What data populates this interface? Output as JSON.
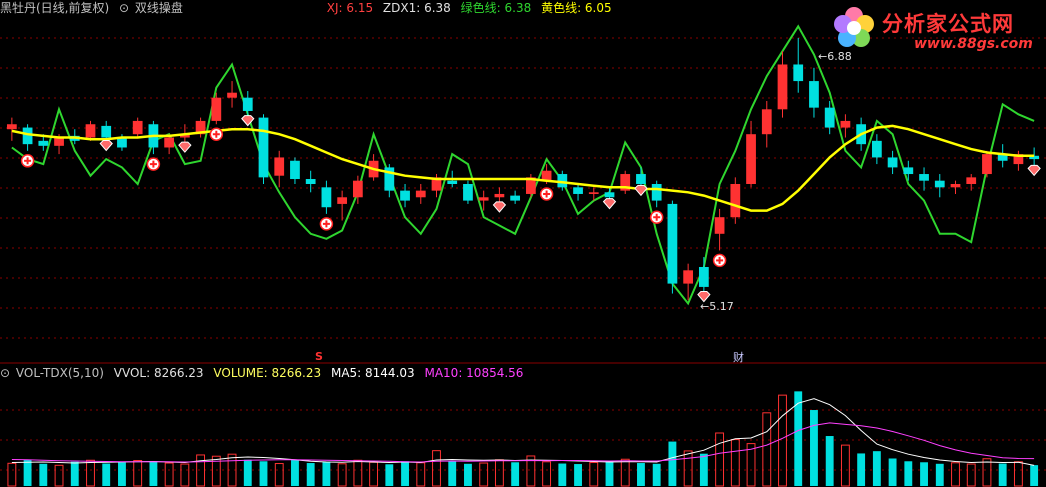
{
  "header": {
    "stock_name": "黑牡丹(日线,前复权)",
    "indicator_name": "双线操盘",
    "xj_label": "XJ: 6.15",
    "zdx1_label": "ZDX1: 6.38",
    "green_label": "绿色线: 6.38",
    "yellow_label": "黄色线: 6.05"
  },
  "volume_header": {
    "name": "VOL-TDX(5,10)",
    "vvol": "VVOL: 8266.23",
    "volume": "VOLUME: 8266.23",
    "ma5": "MA5: 8144.03",
    "ma10": "MA10: 10854.56"
  },
  "annotations": {
    "high_label": "6.88",
    "low_label": "5.17",
    "marker_s": "S",
    "marker_cai": "财"
  },
  "logo": {
    "name": "分析家公式网",
    "url": "www.88gs.com"
  },
  "colors": {
    "up": "#ff3232",
    "down": "#00e0e0",
    "yellow": "#ffff00",
    "green": "#2fd62f",
    "ma10": "#ff40ff",
    "grid": "#8a0000"
  },
  "chart_data": [
    {
      "type": "candlestick",
      "ylim": [
        5.0,
        7.0
      ],
      "low_annotation": 5.17,
      "high_annotation": 6.88,
      "yellow_line": [
        6.32,
        6.3,
        6.29,
        6.28,
        6.28,
        6.27,
        6.27,
        6.28,
        6.28,
        6.29,
        6.29,
        6.3,
        6.31,
        6.32,
        6.33,
        6.33,
        6.32,
        6.3,
        6.27,
        6.23,
        6.19,
        6.15,
        6.12,
        6.09,
        6.07,
        6.05,
        6.04,
        6.03,
        6.03,
        6.03,
        6.03,
        6.03,
        6.03,
        6.03,
        6.02,
        6.01,
        6.0,
        5.99,
        5.98,
        5.98,
        5.97,
        5.97,
        5.96,
        5.95,
        5.93,
        5.9,
        5.87,
        5.84,
        5.84,
        5.88,
        5.96,
        6.06,
        6.16,
        6.24,
        6.3,
        6.34,
        6.35,
        6.33,
        6.3,
        6.27,
        6.24,
        6.21,
        6.19,
        6.18,
        6.17,
        6.17
      ],
      "green_line": [
        6.22,
        6.15,
        6.12,
        6.45,
        6.2,
        6.05,
        6.15,
        6.1,
        6.0,
        6.26,
        6.3,
        6.12,
        6.14,
        6.58,
        6.72,
        6.42,
        6.12,
        5.95,
        5.8,
        5.7,
        5.67,
        5.72,
        5.95,
        6.3,
        6.05,
        5.8,
        5.7,
        5.85,
        6.18,
        6.12,
        5.8,
        5.75,
        5.7,
        5.92,
        6.15,
        6.02,
        5.82,
        5.9,
        5.95,
        6.25,
        6.1,
        5.7,
        5.4,
        5.28,
        5.5,
        6.0,
        6.2,
        6.45,
        6.65,
        6.8,
        6.95,
        6.78,
        6.55,
        6.2,
        6.1,
        6.38,
        6.3,
        6.0,
        5.9,
        5.7,
        5.7,
        5.65,
        6.1,
        6.48,
        6.42,
        6.38
      ],
      "candles": [
        [
          6.33,
          6.4,
          6.26,
          6.36
        ],
        [
          6.34,
          6.36,
          6.2,
          6.24
        ],
        [
          6.26,
          6.3,
          6.2,
          6.23
        ],
        [
          6.23,
          6.3,
          6.18,
          6.28
        ],
        [
          6.29,
          6.33,
          6.24,
          6.26
        ],
        [
          6.28,
          6.38,
          6.26,
          6.36
        ],
        [
          6.35,
          6.38,
          6.25,
          6.28
        ],
        [
          6.28,
          6.3,
          6.2,
          6.22
        ],
        [
          6.3,
          6.4,
          6.28,
          6.38
        ],
        [
          6.36,
          6.38,
          6.18,
          6.22
        ],
        [
          6.22,
          6.3,
          6.18,
          6.28
        ],
        [
          6.28,
          6.36,
          6.24,
          6.3
        ],
        [
          6.3,
          6.4,
          6.28,
          6.38
        ],
        [
          6.38,
          6.55,
          6.36,
          6.52
        ],
        [
          6.52,
          6.62,
          6.46,
          6.55
        ],
        [
          6.52,
          6.56,
          6.4,
          6.44
        ],
        [
          6.4,
          6.42,
          6.0,
          6.04
        ],
        [
          6.05,
          6.2,
          5.98,
          6.16
        ],
        [
          6.14,
          6.16,
          6.0,
          6.03
        ],
        [
          6.03,
          6.08,
          5.95,
          6.0
        ],
        [
          5.98,
          6.02,
          5.82,
          5.86
        ],
        [
          5.88,
          5.96,
          5.78,
          5.92
        ],
        [
          5.92,
          6.05,
          5.88,
          6.02
        ],
        [
          6.04,
          6.18,
          6.02,
          6.14
        ],
        [
          6.1,
          6.12,
          5.92,
          5.96
        ],
        [
          5.96,
          6.0,
          5.86,
          5.9
        ],
        [
          5.92,
          6.0,
          5.88,
          5.96
        ],
        [
          5.96,
          6.06,
          5.92,
          6.04
        ],
        [
          6.02,
          6.08,
          5.98,
          6.0
        ],
        [
          6.0,
          6.02,
          5.88,
          5.9
        ],
        [
          5.9,
          5.96,
          5.84,
          5.92
        ],
        [
          5.92,
          5.98,
          5.88,
          5.94
        ],
        [
          5.93,
          5.96,
          5.88,
          5.9
        ],
        [
          5.94,
          6.06,
          5.92,
          6.04
        ],
        [
          6.02,
          6.12,
          6.0,
          6.08
        ],
        [
          6.06,
          6.08,
          5.96,
          5.98
        ],
        [
          5.98,
          6.0,
          5.9,
          5.94
        ],
        [
          5.94,
          5.98,
          5.9,
          5.95
        ],
        [
          5.95,
          5.98,
          5.9,
          5.92
        ],
        [
          5.96,
          6.08,
          5.94,
          6.06
        ],
        [
          6.06,
          6.1,
          5.98,
          6.0
        ],
        [
          6.0,
          6.02,
          5.86,
          5.9
        ],
        [
          5.88,
          5.9,
          5.34,
          5.4
        ],
        [
          5.4,
          5.52,
          5.3,
          5.48
        ],
        [
          5.5,
          5.56,
          5.34,
          5.38
        ],
        [
          5.7,
          5.85,
          5.6,
          5.8
        ],
        [
          5.8,
          6.04,
          5.76,
          6.0
        ],
        [
          6.0,
          6.38,
          5.98,
          6.3
        ],
        [
          6.3,
          6.5,
          6.22,
          6.45
        ],
        [
          6.45,
          6.8,
          6.4,
          6.72
        ],
        [
          6.72,
          6.88,
          6.55,
          6.62
        ],
        [
          6.62,
          6.7,
          6.4,
          6.46
        ],
        [
          6.46,
          6.5,
          6.3,
          6.34
        ],
        [
          6.34,
          6.42,
          6.28,
          6.38
        ],
        [
          6.36,
          6.4,
          6.2,
          6.24
        ],
        [
          6.26,
          6.3,
          6.12,
          6.16
        ],
        [
          6.16,
          6.2,
          6.06,
          6.1
        ],
        [
          6.1,
          6.14,
          6.02,
          6.06
        ],
        [
          6.06,
          6.1,
          5.96,
          6.02
        ],
        [
          6.02,
          6.06,
          5.92,
          5.98
        ],
        [
          5.98,
          6.02,
          5.94,
          6.0
        ],
        [
          6.0,
          6.06,
          5.96,
          6.04
        ],
        [
          6.06,
          6.2,
          6.04,
          6.18
        ],
        [
          6.18,
          6.24,
          6.1,
          6.14
        ],
        [
          6.12,
          6.2,
          6.08,
          6.18
        ],
        [
          6.17,
          6.22,
          6.1,
          6.15
        ]
      ]
    },
    {
      "type": "bar",
      "ylim": [
        0,
        42000
      ],
      "volume": [
        9000,
        10500,
        8800,
        8200,
        9600,
        10200,
        8900,
        9300,
        10100,
        9800,
        9100,
        8700,
        12300,
        11800,
        12600,
        10400,
        9800,
        8900,
        10300,
        9100,
        9600,
        8800,
        10200,
        9400,
        8600,
        9800,
        9200,
        14000,
        9900,
        8800,
        9100,
        10400,
        9400,
        11900,
        9600,
        8900,
        8700,
        9300,
        9800,
        10600,
        9100,
        8800,
        17600,
        13900,
        12800,
        21000,
        18400,
        16800,
        29000,
        36000,
        37500,
        30100,
        19800,
        16200,
        12900,
        13800,
        10900,
        9800,
        9400,
        8800,
        9200,
        8700,
        10800,
        8900,
        9600,
        8266
      ],
      "ma5": [
        9300,
        9400,
        9500,
        9300,
        9100,
        9300,
        9400,
        9500,
        9600,
        9700,
        9500,
        9300,
        10000,
        10500,
        11200,
        11500,
        11300,
        10900,
        10400,
        9800,
        9500,
        9400,
        9700,
        9500,
        9300,
        9500,
        9300,
        10300,
        10500,
        10300,
        10200,
        10300,
        10100,
        10300,
        10200,
        10100,
        9900,
        9700,
        9500,
        9600,
        9600,
        9500,
        11200,
        12700,
        14200,
        16900,
        18700,
        19000,
        21500,
        27800,
        32800,
        34600,
        32200,
        27900,
        22000,
        16600,
        14400,
        12600,
        11300,
        10300,
        9700,
        9300,
        9500,
        9300,
        9400,
        8144
      ],
      "ma10": [
        10500,
        10400,
        10200,
        10000,
        9900,
        9800,
        9700,
        9600,
        9600,
        9600,
        9600,
        9500,
        9600,
        9800,
        10000,
        10200,
        10300,
        10400,
        10400,
        10300,
        10200,
        10100,
        10000,
        9900,
        9800,
        9600,
        9500,
        9800,
        9900,
        9800,
        9900,
        10000,
        10000,
        10100,
        10000,
        10100,
        10100,
        10000,
        9900,
        10000,
        9900,
        9900,
        10400,
        11000,
        11700,
        13000,
        13800,
        14600,
        16200,
        18900,
        22000,
        24000,
        25000,
        24400,
        23900,
        23000,
        21600,
        19900,
        18100,
        16000,
        14300,
        13000,
        12100,
        11200,
        10900,
        10854
      ]
    }
  ]
}
